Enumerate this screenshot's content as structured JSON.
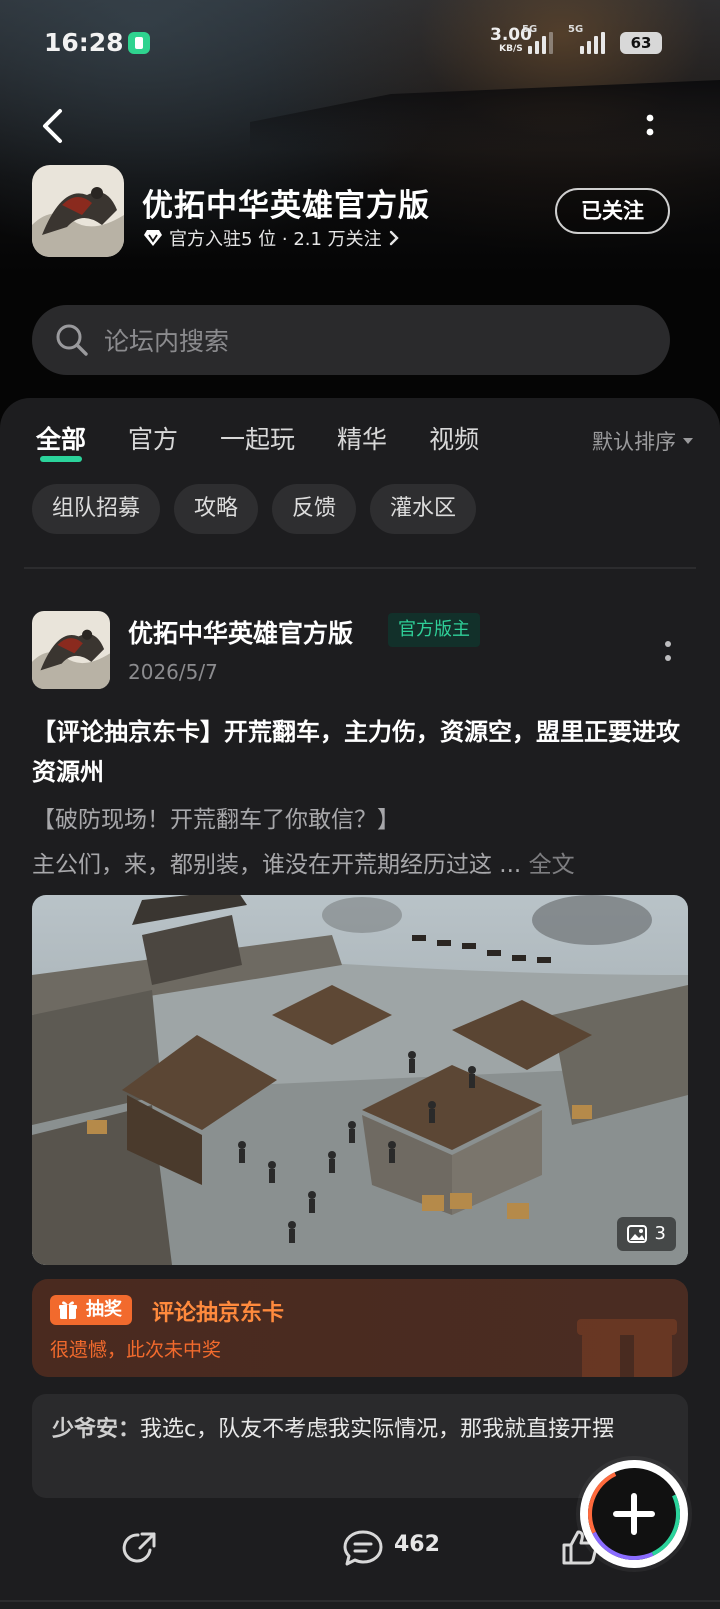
{
  "status_bar": {
    "time": "16:28",
    "net_speed": "3.00",
    "net_unit": "KB/S",
    "sim1_tag": "5G",
    "sim2_tag": "5G",
    "battery": "63"
  },
  "forum": {
    "name": "优拓中华英雄官方版",
    "meta": "官方入驻5 位 · 2.1 万关注",
    "follow_label": "已关注"
  },
  "search": {
    "placeholder": "论坛内搜索"
  },
  "tabs": [
    {
      "label": "全部",
      "active": true
    },
    {
      "label": "官方"
    },
    {
      "label": "一起玩"
    },
    {
      "label": "精华"
    },
    {
      "label": "视频"
    }
  ],
  "sort_label": "默认排序",
  "chips": [
    "组队招募",
    "攻略",
    "反馈",
    "灌水区"
  ],
  "post": {
    "author": "优拓中华英雄官方版",
    "badge": "官方版主",
    "date": "2026/5/7",
    "title": "【评论抽京东卡】开荒翻车，主力伤，资源空，盟里正要进攻资源州",
    "excerpt_line1": "【破防现场！开荒翻车了你敢信？】",
    "excerpt_line2": "主公们，来，都别装，谁没在开荒期经历过这 ...",
    "full_text_label": "全文",
    "image_count": "3",
    "lottery": {
      "tag": "抽奖",
      "title": "评论抽京东卡",
      "result": "很遗憾，此次未中奖"
    },
    "comment": {
      "user": "少爷安：",
      "text": "我选c，队友不考虑我实际情况，那我就直接开摆"
    },
    "comment_count": "462"
  }
}
